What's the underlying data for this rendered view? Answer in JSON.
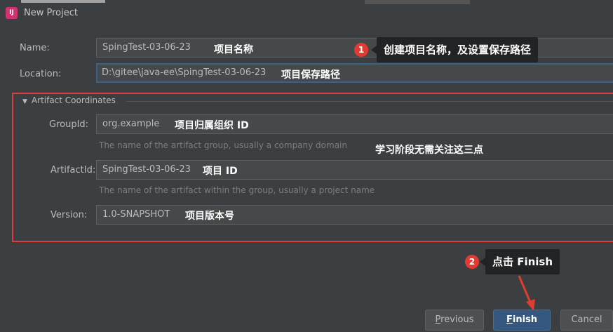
{
  "window": {
    "title": "New Project",
    "icon_label": "IJ"
  },
  "form": {
    "name_label": "Name:",
    "name_value": "SpingTest-03-06-23",
    "name_note": "项目名称",
    "location_label": "Location:",
    "location_value": "D:\\gitee\\java-ee\\SpingTest-03-06-23",
    "location_note": "项目保存路径"
  },
  "artifact": {
    "header": "Artifact Coordinates",
    "groupid_label": "GroupId:",
    "groupid_value": "org.example",
    "groupid_note": "项目归属组织 ID",
    "groupid_hint": "The name of the artifact group, usually a company domain",
    "study_note": "学习阶段无需关注这三点",
    "artifactid_label": "ArtifactId:",
    "artifactid_value": "SpingTest-03-06-23",
    "artifactid_note": "项目 ID",
    "artifactid_hint": "The name of the artifact within the group, usually a project name",
    "version_label": "Version:",
    "version_value": "1.0-SNAPSHOT",
    "version_note": "项目版本号"
  },
  "annotations": {
    "badge1": "1",
    "callout1": "创建项目名称，及设置保存路径",
    "badge2": "2",
    "callout2": "点击 Finish"
  },
  "buttons": {
    "previous_mnemonic": "P",
    "previous_rest": "revious",
    "finish_mnemonic": "F",
    "finish_rest": "inish",
    "cancel": "Cancel"
  },
  "colors": {
    "background": "#3c3f41",
    "highlight_box": "#e23b3b",
    "primary_button": "#365880",
    "badge": "#e03c31"
  }
}
